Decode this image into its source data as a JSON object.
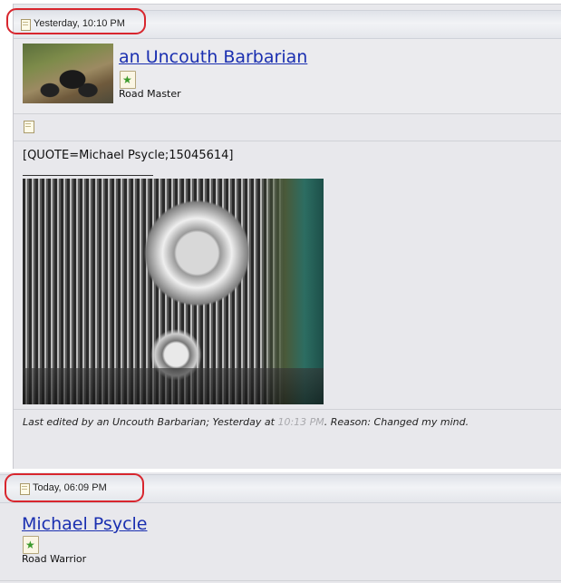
{
  "posts": [
    {
      "date": "Yesterday, 10:10 PM",
      "username": "an Uncouth Barbarian",
      "user_title": "Road Master",
      "quote_text": "[QUOTE=Michael Psycle;15045614]",
      "edit_note": {
        "prefix": "Last edited by an Uncouth Barbarian; Yesterday at ",
        "time": "10:13 PM",
        "suffix": ". Reason: Changed my mind."
      }
    },
    {
      "date": "Today, 06:09 PM",
      "username": "Michael Psycle",
      "user_title": "Road Warrior"
    }
  ],
  "icons": {
    "date": "document-icon",
    "rank": "rank-badge-icon",
    "post": "post-document-icon"
  },
  "colors": {
    "username_link": "#1a2fb0",
    "highlight_circle": "#d8262e",
    "edit_time": "#a9a9ad"
  }
}
